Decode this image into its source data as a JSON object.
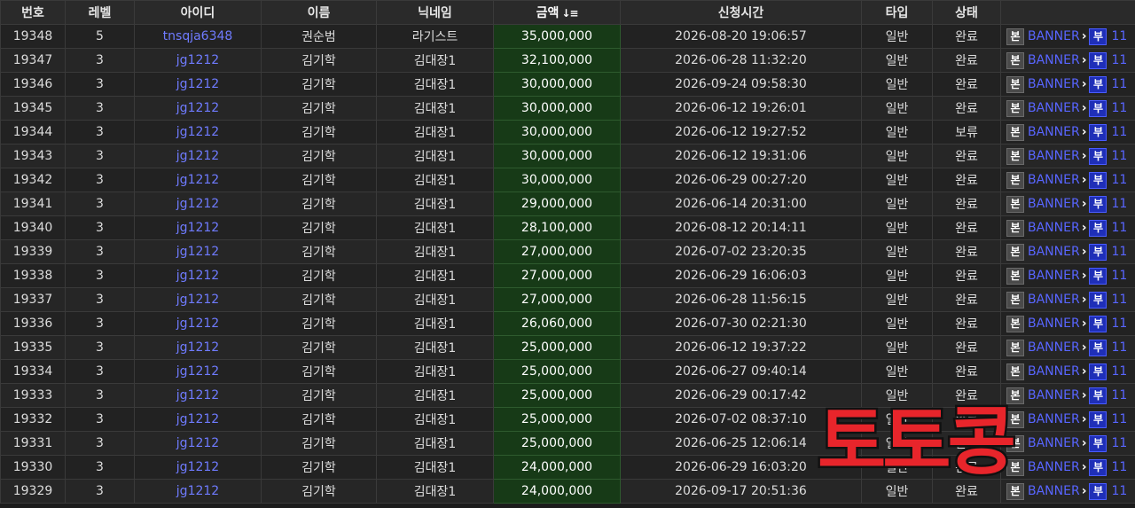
{
  "headers": [
    "번호",
    "레벨",
    "아이디",
    "이름",
    "닉네임",
    "금액",
    "신청시간",
    "타입",
    "상태",
    ""
  ],
  "sort_icon": "↓≡",
  "badge_labels": {
    "main": "본",
    "sub": "부",
    "banner": "BANNER",
    "chevron": "›"
  },
  "rows": [
    {
      "no": "19348",
      "level": "5",
      "id": "tnsqja6348",
      "name": "권순범",
      "nick": "라기스트",
      "amount": "35,000,000",
      "time": "2026-08-20 19:06:57",
      "type": "일반",
      "status": "완료",
      "count": "11"
    },
    {
      "no": "19347",
      "level": "3",
      "id": "jg1212",
      "name": "김기학",
      "nick": "김대장1",
      "amount": "32,100,000",
      "time": "2026-06-28 11:32:20",
      "type": "일반",
      "status": "완료",
      "count": "11"
    },
    {
      "no": "19346",
      "level": "3",
      "id": "jg1212",
      "name": "김기학",
      "nick": "김대장1",
      "amount": "30,000,000",
      "time": "2026-09-24 09:58:30",
      "type": "일반",
      "status": "완료",
      "count": "11"
    },
    {
      "no": "19345",
      "level": "3",
      "id": "jg1212",
      "name": "김기학",
      "nick": "김대장1",
      "amount": "30,000,000",
      "time": "2026-06-12 19:26:01",
      "type": "일반",
      "status": "완료",
      "count": "11"
    },
    {
      "no": "19344",
      "level": "3",
      "id": "jg1212",
      "name": "김기학",
      "nick": "김대장1",
      "amount": "30,000,000",
      "time": "2026-06-12 19:27:52",
      "type": "일반",
      "status": "보류",
      "count": "11"
    },
    {
      "no": "19343",
      "level": "3",
      "id": "jg1212",
      "name": "김기학",
      "nick": "김대장1",
      "amount": "30,000,000",
      "time": "2026-06-12 19:31:06",
      "type": "일반",
      "status": "완료",
      "count": "11"
    },
    {
      "no": "19342",
      "level": "3",
      "id": "jg1212",
      "name": "김기학",
      "nick": "김대장1",
      "amount": "30,000,000",
      "time": "2026-06-29 00:27:20",
      "type": "일반",
      "status": "완료",
      "count": "11"
    },
    {
      "no": "19341",
      "level": "3",
      "id": "jg1212",
      "name": "김기학",
      "nick": "김대장1",
      "amount": "29,000,000",
      "time": "2026-06-14 20:31:00",
      "type": "일반",
      "status": "완료",
      "count": "11"
    },
    {
      "no": "19340",
      "level": "3",
      "id": "jg1212",
      "name": "김기학",
      "nick": "김대장1",
      "amount": "28,100,000",
      "time": "2026-08-12 20:14:11",
      "type": "일반",
      "status": "완료",
      "count": "11"
    },
    {
      "no": "19339",
      "level": "3",
      "id": "jg1212",
      "name": "김기학",
      "nick": "김대장1",
      "amount": "27,000,000",
      "time": "2026-07-02 23:20:35",
      "type": "일반",
      "status": "완료",
      "count": "11"
    },
    {
      "no": "19338",
      "level": "3",
      "id": "jg1212",
      "name": "김기학",
      "nick": "김대장1",
      "amount": "27,000,000",
      "time": "2026-06-29 16:06:03",
      "type": "일반",
      "status": "완료",
      "count": "11"
    },
    {
      "no": "19337",
      "level": "3",
      "id": "jg1212",
      "name": "김기학",
      "nick": "김대장1",
      "amount": "27,000,000",
      "time": "2026-06-28 11:56:15",
      "type": "일반",
      "status": "완료",
      "count": "11"
    },
    {
      "no": "19336",
      "level": "3",
      "id": "jg1212",
      "name": "김기학",
      "nick": "김대장1",
      "amount": "26,060,000",
      "time": "2026-07-30 02:21:30",
      "type": "일반",
      "status": "완료",
      "count": "11"
    },
    {
      "no": "19335",
      "level": "3",
      "id": "jg1212",
      "name": "김기학",
      "nick": "김대장1",
      "amount": "25,000,000",
      "time": "2026-06-12 19:37:22",
      "type": "일반",
      "status": "완료",
      "count": "11"
    },
    {
      "no": "19334",
      "level": "3",
      "id": "jg1212",
      "name": "김기학",
      "nick": "김대장1",
      "amount": "25,000,000",
      "time": "2026-06-27 09:40:14",
      "type": "일반",
      "status": "완료",
      "count": "11"
    },
    {
      "no": "19333",
      "level": "3",
      "id": "jg1212",
      "name": "김기학",
      "nick": "김대장1",
      "amount": "25,000,000",
      "time": "2026-06-29 00:17:42",
      "type": "일반",
      "status": "완료",
      "count": "11"
    },
    {
      "no": "19332",
      "level": "3",
      "id": "jg1212",
      "name": "김기학",
      "nick": "김대장1",
      "amount": "25,000,000",
      "time": "2026-07-02 08:37:10",
      "type": "일반",
      "status": "완료",
      "count": "11"
    },
    {
      "no": "19331",
      "level": "3",
      "id": "jg1212",
      "name": "김기학",
      "nick": "김대장1",
      "amount": "25,000,000",
      "time": "2026-06-25 12:06:14",
      "type": "일반",
      "status": "완료",
      "count": "11"
    },
    {
      "no": "19330",
      "level": "3",
      "id": "jg1212",
      "name": "김기학",
      "nick": "김대장1",
      "amount": "24,000,000",
      "time": "2026-06-29 16:03:20",
      "type": "일반",
      "status": "완료",
      "count": "11"
    },
    {
      "no": "19329",
      "level": "3",
      "id": "jg1212",
      "name": "김기학",
      "nick": "김대장1",
      "amount": "24,000,000",
      "time": "2026-09-17 20:51:36",
      "type": "일반",
      "status": "완료",
      "count": "11"
    }
  ],
  "watermark": "토토콩",
  "colors": {
    "amount_bg": "#173a17",
    "link": "#6f7bff",
    "watermark": "#e8252b"
  }
}
